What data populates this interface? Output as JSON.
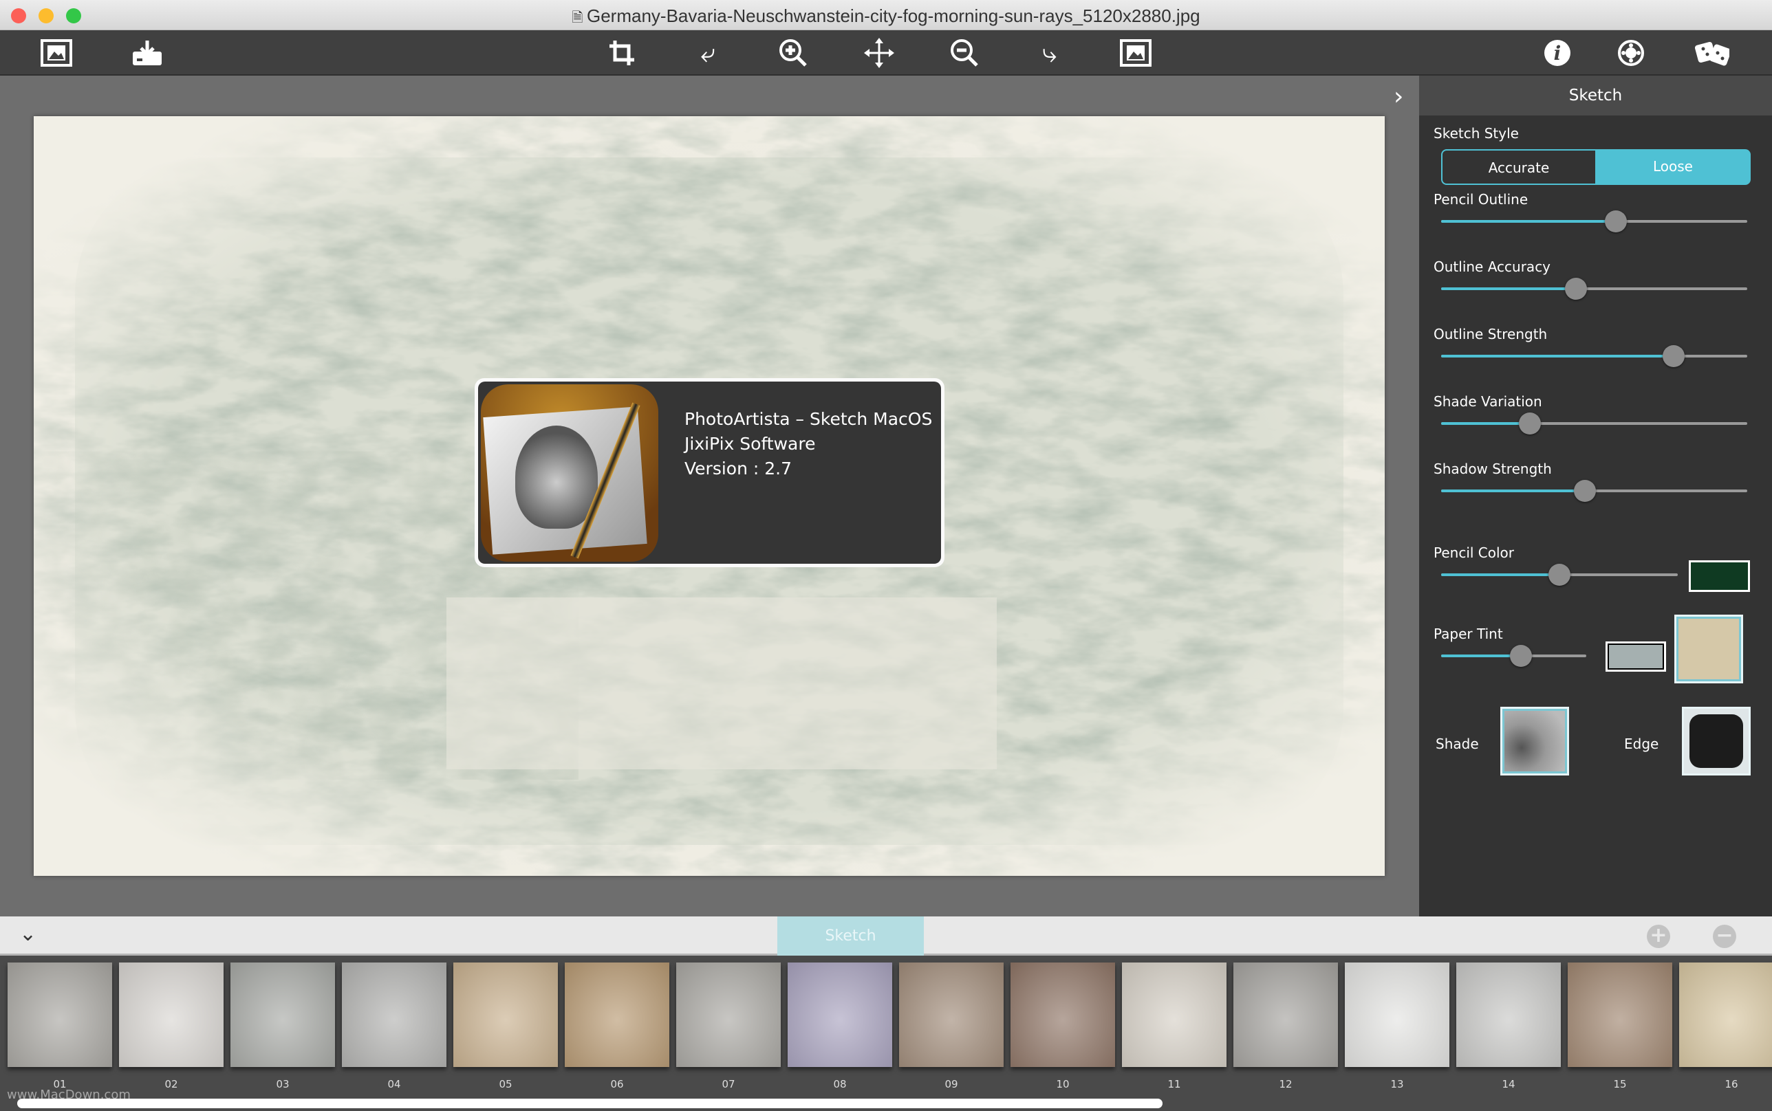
{
  "window": {
    "title": "Germany-Bavaria-Neuschwanstein-city-fog-morning-sun-rays_5120x2880.jpg"
  },
  "toolbar": {
    "icons": [
      "open-image-icon",
      "save-icon",
      "crop-icon",
      "rotate-left-icon",
      "zoom-in-icon",
      "move-icon",
      "zoom-out-icon",
      "rotate-right-icon",
      "fit-image-icon",
      "info-icon",
      "settings-icon",
      "random-icon"
    ]
  },
  "panel": {
    "title": "Sketch",
    "sketch_style": {
      "label": "Sketch Style",
      "options": [
        "Accurate",
        "Loose"
      ],
      "selected": "Loose"
    },
    "sliders": [
      {
        "label": "Pencil Outline",
        "value": 0.57
      },
      {
        "label": "Outline Accuracy",
        "value": 0.44
      },
      {
        "label": "Outline Strength",
        "value": 0.76
      },
      {
        "label": "Shade Variation",
        "value": 0.29
      },
      {
        "label": "Shadow Strength",
        "value": 0.47
      }
    ],
    "pencil_color": {
      "label": "Pencil Color",
      "value": 0.5,
      "color": "#0f3a22"
    },
    "paper_tint": {
      "label": "Paper Tint",
      "value": 0.55,
      "color": "#a5b0b0",
      "paper_color": "#d5c8a8"
    },
    "shade_label": "Shade",
    "edge_label": "Edge",
    "accent": "#4fc1d4"
  },
  "about": {
    "line1": "PhotoArtista – Sketch MacOS",
    "line2": "JixiPix Software",
    "line3": "Version : 2.7"
  },
  "bottom": {
    "tab": "Sketch",
    "add": "+",
    "remove": "−"
  },
  "presets": [
    {
      "num": "01",
      "color": "#a9a7a2"
    },
    {
      "num": "02",
      "color": "#d9d6d2"
    },
    {
      "num": "03",
      "color": "#a8aaa6"
    },
    {
      "num": "04",
      "color": "#b3b3b1"
    },
    {
      "num": "05",
      "color": "#c9b18f"
    },
    {
      "num": "06",
      "color": "#b89a73"
    },
    {
      "num": "07",
      "color": "#aaa8a3"
    },
    {
      "num": "08",
      "color": "#a9a3bf"
    },
    {
      "num": "09",
      "color": "#a18c7a"
    },
    {
      "num": "10",
      "color": "#8f7566"
    },
    {
      "num": "11",
      "color": "#d6d0c6"
    },
    {
      "num": "12",
      "color": "#a5a39f"
    },
    {
      "num": "13",
      "color": "#e4e4e2"
    },
    {
      "num": "14",
      "color": "#c8c8c6"
    },
    {
      "num": "15",
      "color": "#a08670"
    },
    {
      "num": "16",
      "color": "#d8c7a2"
    }
  ],
  "watermark": "www.MacDown.com"
}
